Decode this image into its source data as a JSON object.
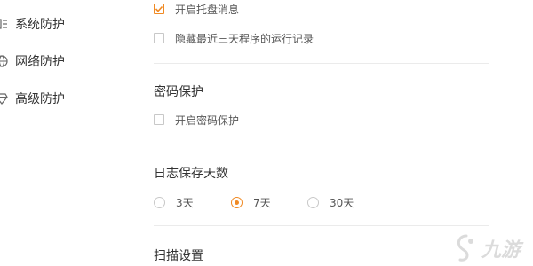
{
  "sidebar": {
    "items": [
      {
        "label": "系统防护",
        "icon": "system-protect-icon"
      },
      {
        "label": "网络防护",
        "icon": "globe-icon"
      },
      {
        "label": "高级防护",
        "icon": "diamond-icon"
      }
    ]
  },
  "main": {
    "options": [
      {
        "label": "开启托盘消息",
        "checked": true
      },
      {
        "label": "隐藏最近三天程序的运行记录",
        "checked": false
      }
    ],
    "password_section": {
      "title": "密码保护",
      "option": {
        "label": "开启密码保护",
        "checked": false
      }
    },
    "log_section": {
      "title": "日志保存天数",
      "options": [
        "3天",
        "7天",
        "30天"
      ],
      "selected": "7天"
    },
    "scan_section": {
      "title": "扫描设置"
    }
  },
  "watermark": {
    "text": "九游"
  },
  "colors": {
    "accent": "#f08a24",
    "divider": "#ebebeb",
    "sidebar_border": "#e8e8e8"
  }
}
